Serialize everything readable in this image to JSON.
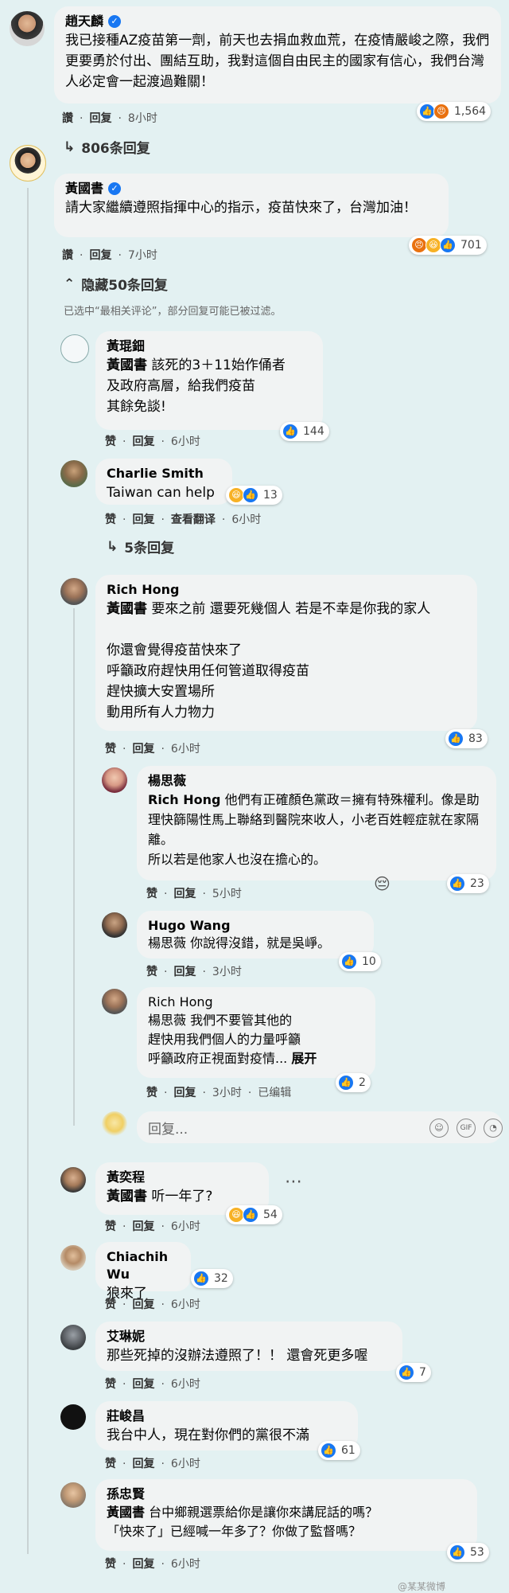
{
  "comments": [
    {
      "name": "趙天麟",
      "verified": true,
      "text": "我已接種AZ疫苗第一劑，前天也去捐血救血荒，在疫情嚴峻之際，我們更要勇於付出、團結互助，我對這個自由民主的國家有信心，我們台灣人必定會一起渡過難關！",
      "like": "讚",
      "reply": "回复",
      "time": "8小时",
      "react_count": "1,564"
    },
    {
      "name": "黃國書",
      "verified": true,
      "text": "請大家繼續遵照指揮中心的指示，疫苗快來了，台灣加油！",
      "like": "讚",
      "reply": "回复",
      "time": "7小时",
      "react_count": "701"
    }
  ],
  "replies_806": "806条回复",
  "hide_replies": "隐藏50条回复",
  "filter_note": "已选中“最相关评论”，部分回复可能已被过滤。",
  "replies": [
    {
      "name": "黃琨鈿",
      "mention": "黃國書",
      "text": " 該死的3＋11始作俑者\n及政府高層，給我們疫苗\n其餘免談!",
      "like": "赞",
      "reply": "回复",
      "time": "6小时",
      "react_count": "144"
    },
    {
      "name": "Charlie Smith",
      "text": "Taiwan can help",
      "like": "赞",
      "reply": "回复",
      "translate": "查看翻译",
      "time": "6小时",
      "react_count": "13"
    },
    {
      "name": "Rich Hong",
      "mention": "黃國書",
      "text": " 要來之前 還要死幾個人 若是不幸是你我的家人\n\n你還會覺得疫苗快來了\n呼籲政府趕快用任何管道取得疫苗\n趕快擴大安置場所\n動用所有人力物力",
      "like": "赞",
      "reply": "回复",
      "time": "6小时",
      "react_count": "83"
    }
  ],
  "replies_5": "5条回复",
  "nested": [
    {
      "name": "楊思薇",
      "mention": "Rich Hong",
      "text": " 他們有正確顏色黨政＝擁有特殊權利。像是助理快篩陽性馬上聯絡到醫院來收人，小老百姓輕症就在家隔離。\n所以若是他家人也沒在擔心的。",
      "like": "赞",
      "reply": "回复",
      "time": "5小时",
      "react_count": "23"
    },
    {
      "name": "Hugo Wang",
      "text": "楊思薇 你說得沒錯，就是吳崢。",
      "like": "赞",
      "reply": "回复",
      "time": "3小时",
      "react_count": "10"
    },
    {
      "name": "Rich Hong",
      "text": "楊思薇 我們不要管其他的\n趕快用我們個人的力量呼籲\n呼籲政府正視面對疫情...",
      "more": "展开",
      "like": "赞",
      "reply": "回复",
      "time": "3小时",
      "edited": "已编辑",
      "react_count": "2"
    }
  ],
  "reply_placeholder": "回复...",
  "more_comments": [
    {
      "name": "黃奕程",
      "mention": "黃國書",
      "text": " 听一年了?",
      "like": "赞",
      "reply": "回复",
      "time": "6小时",
      "react_count": "54"
    },
    {
      "name": "Chiachih Wu",
      "text": "狼來了",
      "like": "赞",
      "reply": "回复",
      "time": "6小时",
      "react_count": "32"
    },
    {
      "name": "艾琳妮",
      "text": "那些死掉的沒辦法遵照了！！ 還會死更多喔",
      "like": "赞",
      "reply": "回复",
      "time": "6小时",
      "react_count": "7"
    },
    {
      "name": "莊峻昌",
      "text": "我台中人，現在對你們的黨很不滿",
      "like": "赞",
      "reply": "回复",
      "time": "6小时",
      "react_count": "61"
    },
    {
      "name": "孫忠賢",
      "mention": "黃國書",
      "text": " 台中鄉親選票給你是讓你來講屁話的嗎？\n「快來了」已經喊一年多了？你做了監督嗎？",
      "like": "赞",
      "reply": "回复",
      "time": "6小时",
      "react_count": "53"
    }
  ],
  "watermark": "@某某微博",
  "colors": {
    "bg": "#e3f1f2",
    "bubble": "#f1f3f3",
    "like": "#1877f2"
  }
}
